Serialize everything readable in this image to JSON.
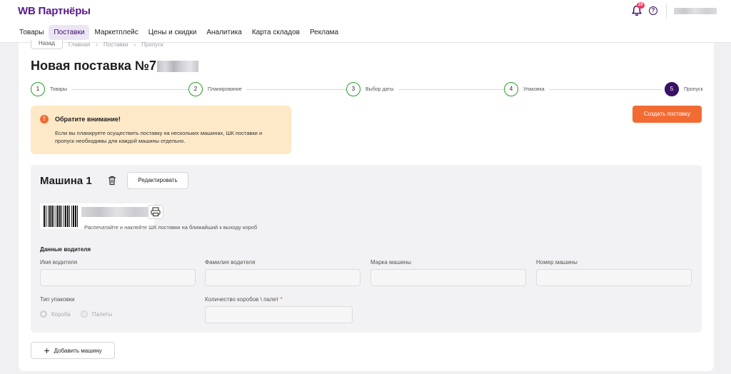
{
  "header": {
    "logo": "WB Партнёры",
    "notification_count": "20",
    "help_icon": "question-circle-icon",
    "bell_icon": "bell-icon"
  },
  "nav": {
    "items": [
      {
        "label": "Товары",
        "active": false
      },
      {
        "label": "Поставки",
        "active": true
      },
      {
        "label": "Маркетплейс",
        "active": false
      },
      {
        "label": "Цены и скидки",
        "active": false
      },
      {
        "label": "Аналитика",
        "active": false
      },
      {
        "label": "Карта складов",
        "active": false
      },
      {
        "label": "Реклама",
        "active": false
      }
    ]
  },
  "breadcrumbs": {
    "back": "Назад",
    "items": [
      "Главная",
      "Поставки",
      "Пропуск"
    ]
  },
  "page": {
    "title": "Новая поставка №7"
  },
  "stepper": {
    "steps": [
      {
        "number": "1",
        "label": "Товары",
        "state": "done"
      },
      {
        "number": "2",
        "label": "Планирование",
        "state": "done"
      },
      {
        "number": "3",
        "label": "Выбор даты",
        "state": "done"
      },
      {
        "number": "4",
        "label": "Упаковка",
        "state": "done"
      },
      {
        "number": "5",
        "label": "Пропуск",
        "state": "current"
      }
    ]
  },
  "notice": {
    "title": "Обратите внимание!",
    "text": "Если вы планируете осуществить поставку на нескольких машинах, ШК поставки и пропуск необходимы для каждой машины отдельно.",
    "icon": "exclamation-icon"
  },
  "actions": {
    "create": "Создать поставку",
    "add_machine": "Добавить машину"
  },
  "machine": {
    "title": "Машина 1",
    "edit": "Редактировать",
    "barcode_hint": "Распечатайте и наклейте ШК поставки на ближайший к выходу короб",
    "driver_section": "Данные водителя",
    "fields": {
      "first_name": {
        "label": "Имя водителя",
        "value": ""
      },
      "last_name": {
        "label": "Фамилия водителя",
        "value": ""
      },
      "car_brand": {
        "label": "Марка машины",
        "value": ""
      },
      "car_number": {
        "label": "Номер машины",
        "value": ""
      },
      "package_type": {
        "label": "Тип упаковки"
      },
      "box_count": {
        "label": "Количество коробов \\ палет",
        "required_mark": "*",
        "value": ""
      }
    },
    "package_options": [
      {
        "label": "Короба",
        "selected": true
      },
      {
        "label": "Палеты",
        "selected": false
      }
    ]
  },
  "colors": {
    "brand": "#5a1a8c",
    "accent": "#f26b33",
    "step_done": "#2aa02a",
    "step_current": "#3b1166",
    "notice_bg": "#fde9c7"
  }
}
